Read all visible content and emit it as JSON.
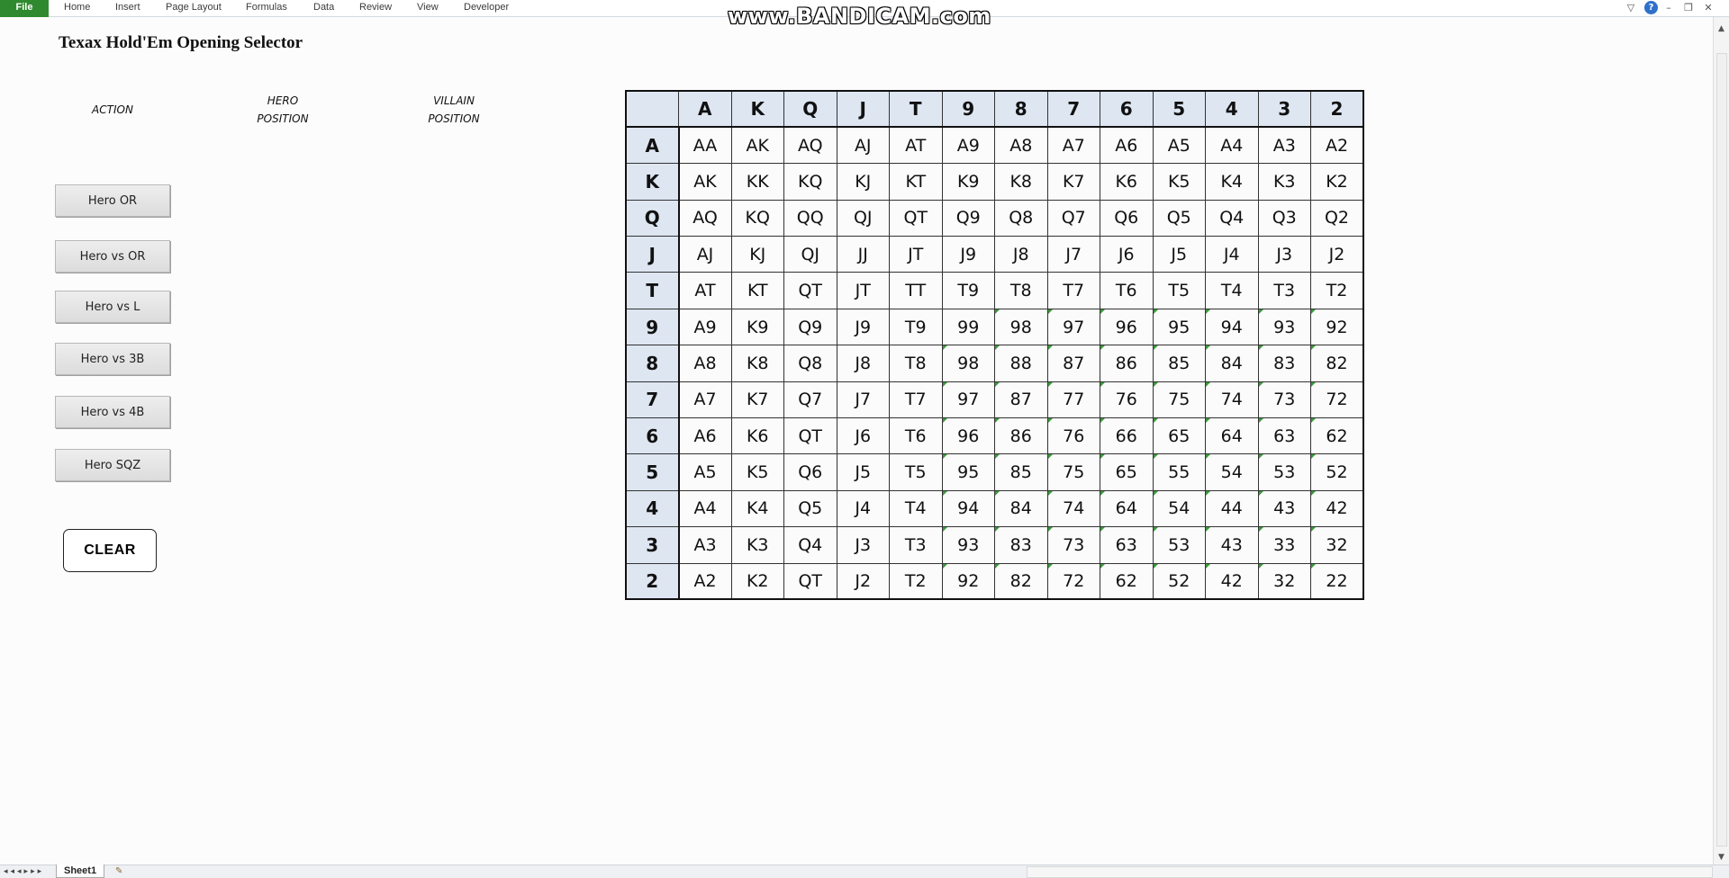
{
  "ribbon": {
    "tabs": [
      "File",
      "Home",
      "Insert",
      "Page Layout",
      "Formulas",
      "Data",
      "Review",
      "View",
      "Developer"
    ],
    "watermark": "www.BANDICAM.com"
  },
  "sheet": {
    "title": "Texax Hold'Em Opening Selector",
    "labels": {
      "action": "ACTION",
      "hero_position": "HERO\nPOSITION",
      "villain_position": "VILLAIN\nPOSITION"
    },
    "buttons": [
      "Hero OR",
      "Hero vs OR",
      "Hero vs L",
      "Hero vs 3B",
      "Hero vs 4B",
      "Hero SQZ"
    ],
    "clear_label": "CLEAR",
    "tab_name": "Sheet1"
  },
  "grid": {
    "ranks": [
      "A",
      "K",
      "Q",
      "J",
      "T",
      "9",
      "8",
      "7",
      "6",
      "5",
      "4",
      "3",
      "2"
    ],
    "rows": [
      [
        "AA",
        "AK",
        "AQ",
        "AJ",
        "AT",
        "A9",
        "A8",
        "A7",
        "A6",
        "A5",
        "A4",
        "A3",
        "A2"
      ],
      [
        "AK",
        "KK",
        "KQ",
        "KJ",
        "KT",
        "K9",
        "K8",
        "K7",
        "K6",
        "K5",
        "K4",
        "K3",
        "K2"
      ],
      [
        "AQ",
        "KQ",
        "QQ",
        "QJ",
        "QT",
        "Q9",
        "Q8",
        "Q7",
        "Q6",
        "Q5",
        "Q4",
        "Q3",
        "Q2"
      ],
      [
        "AJ",
        "KJ",
        "QJ",
        "JJ",
        "JT",
        "J9",
        "J8",
        "J7",
        "J6",
        "J5",
        "J4",
        "J3",
        "J2"
      ],
      [
        "AT",
        "KT",
        "QT",
        "JT",
        "TT",
        "T9",
        "T8",
        "T7",
        "T6",
        "T5",
        "T4",
        "T3",
        "T2"
      ],
      [
        "A9",
        "K9",
        "Q9",
        "J9",
        "T9",
        "99",
        "98",
        "97",
        "96",
        "95",
        "94",
        "93",
        "92"
      ],
      [
        "A8",
        "K8",
        "Q8",
        "J8",
        "T8",
        "98",
        "88",
        "87",
        "86",
        "85",
        "84",
        "83",
        "82"
      ],
      [
        "A7",
        "K7",
        "Q7",
        "J7",
        "T7",
        "97",
        "87",
        "77",
        "76",
        "75",
        "74",
        "73",
        "72"
      ],
      [
        "A6",
        "K6",
        "QT",
        "J6",
        "T6",
        "96",
        "86",
        "76",
        "66",
        "65",
        "64",
        "63",
        "62"
      ],
      [
        "A5",
        "K5",
        "Q6",
        "J5",
        "T5",
        "95",
        "85",
        "75",
        "65",
        "55",
        "54",
        "53",
        "52"
      ],
      [
        "A4",
        "K4",
        "Q5",
        "J4",
        "T4",
        "94",
        "84",
        "74",
        "64",
        "54",
        "44",
        "43",
        "42"
      ],
      [
        "A3",
        "K3",
        "Q4",
        "J3",
        "T3",
        "93",
        "83",
        "73",
        "63",
        "53",
        "43",
        "33",
        "32"
      ],
      [
        "A2",
        "K2",
        "QT",
        "J2",
        "T2",
        "92",
        "82",
        "72",
        "62",
        "52",
        "42",
        "32",
        "22"
      ]
    ],
    "comment_marker_color": "#3a9a3a",
    "header_color": "#dde6f1"
  }
}
